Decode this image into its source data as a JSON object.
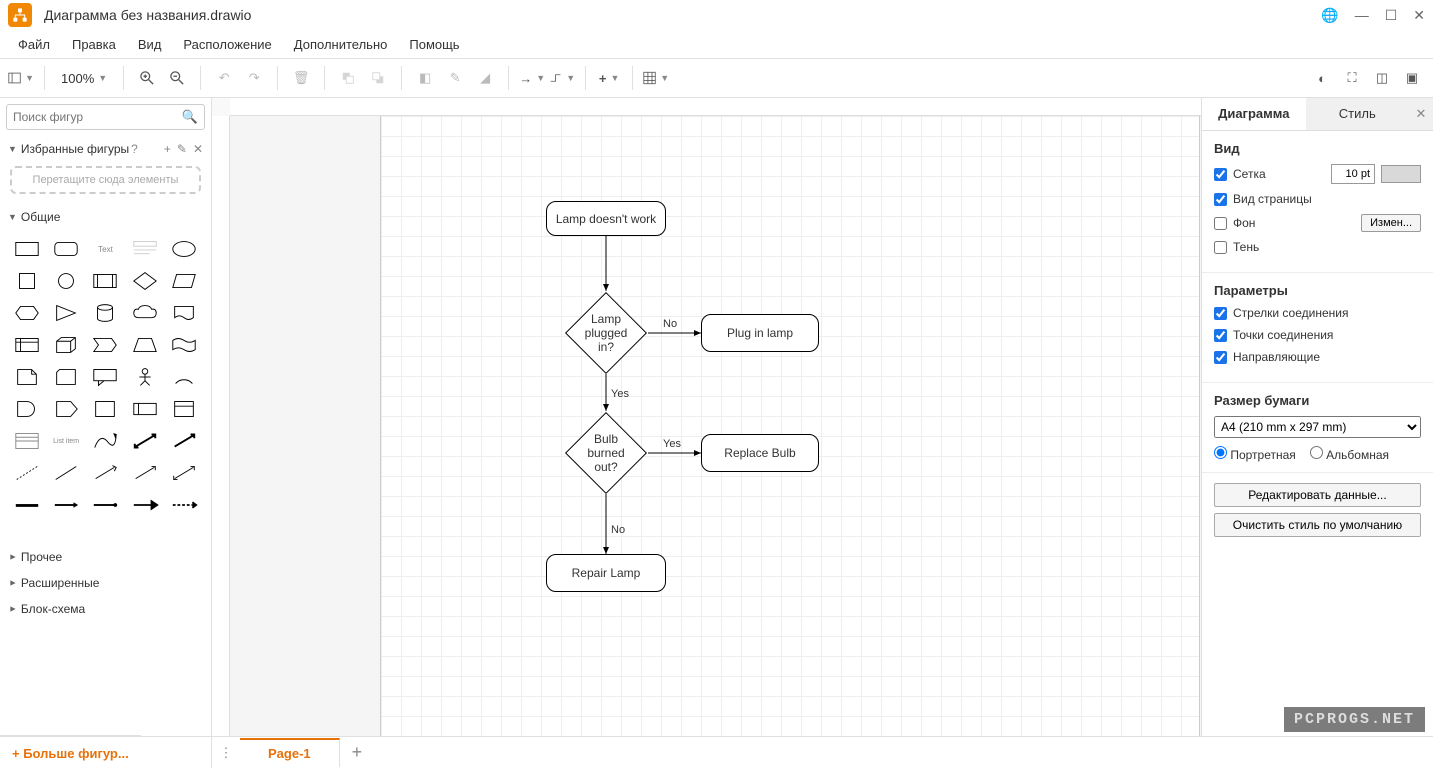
{
  "title": "Диаграмма без названия.drawio",
  "menu": {
    "file": "Файл",
    "edit": "Правка",
    "view": "Вид",
    "arrange": "Расположение",
    "extras": "Дополнительно",
    "help": "Помощь"
  },
  "toolbar": {
    "zoom": "100%"
  },
  "search": {
    "placeholder": "Поиск фигур"
  },
  "sidebar": {
    "favorites": "Избранные фигуры",
    "favorites_help": "?",
    "dropzone": "Перетащите сюда элементы",
    "general": "Общие",
    "misc": "Прочее",
    "advanced": "Расширенные",
    "flowchart": "Блок-схема",
    "more": "+ Больше фигур..."
  },
  "flowchart": {
    "n1": "Lamp doesn't work",
    "n2": "Lamp\nplugged in?",
    "n3": "Plug in lamp",
    "n4": "Bulb\nburned out?",
    "n5": "Replace Bulb",
    "n6": "Repair Lamp",
    "yes": "Yes",
    "no": "No"
  },
  "rightPanel": {
    "tab_diagram": "Диаграмма",
    "tab_style": "Стиль",
    "view": "Вид",
    "grid": "Сетка",
    "grid_size": "10 pt",
    "page_view": "Вид страницы",
    "background": "Фон",
    "change_btn": "Измен...",
    "shadow": "Тень",
    "params": "Параметры",
    "conn_arrows": "Стрелки соединения",
    "conn_points": "Точки соединения",
    "guides": "Направляющие",
    "paper_size": "Размер бумаги",
    "paper_value": "A4 (210 mm x 297 mm)",
    "portrait": "Портретная",
    "landscape": "Альбомная",
    "edit_data": "Редактировать данные...",
    "clear_style": "Очистить стиль по умолчанию"
  },
  "footer": {
    "page": "Page-1"
  },
  "watermark": "PCPROGS.NET"
}
